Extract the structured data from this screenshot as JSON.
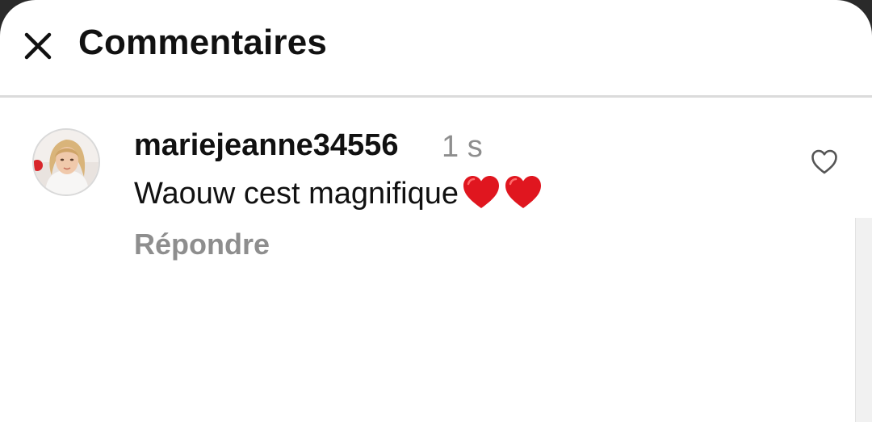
{
  "header": {
    "title": "Commentaires",
    "close_icon": "close-icon"
  },
  "comment": {
    "username": "mariejeanne34556",
    "time": "1 s",
    "text": "Waouw cest magnifique",
    "emojis": [
      "red-heart",
      "red-heart"
    ],
    "reply_label": "Répondre",
    "like_icon": "heart-outline-icon"
  },
  "colors": {
    "text_primary": "#111111",
    "text_secondary": "#8e8e8e",
    "divider": "#dbdbdb",
    "heart": "#e0161f"
  }
}
